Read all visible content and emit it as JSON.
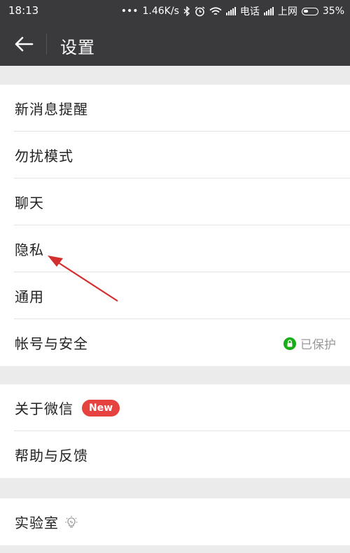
{
  "status": {
    "time": "18:13",
    "dots": "•••",
    "speed": "1.46K/s",
    "carrier1": "电话",
    "carrier2": "上网",
    "battery": "35%"
  },
  "header": {
    "title": "设置"
  },
  "groups": [
    {
      "items": [
        {
          "label": "新消息提醒"
        },
        {
          "label": "勿扰模式"
        },
        {
          "label": "聊天"
        },
        {
          "label": "隐私"
        },
        {
          "label": "通用"
        },
        {
          "label": "帐号与安全",
          "status": "已保护"
        }
      ]
    },
    {
      "items": [
        {
          "label": "关于微信",
          "badge": "New"
        },
        {
          "label": "帮助与反馈"
        }
      ]
    },
    {
      "items": [
        {
          "label": "实验室"
        }
      ]
    }
  ],
  "colors": {
    "header_bg": "#3a3a3c",
    "badge": "#e64340",
    "protect_green": "#1aad19",
    "arrow": "#d32f2f"
  }
}
